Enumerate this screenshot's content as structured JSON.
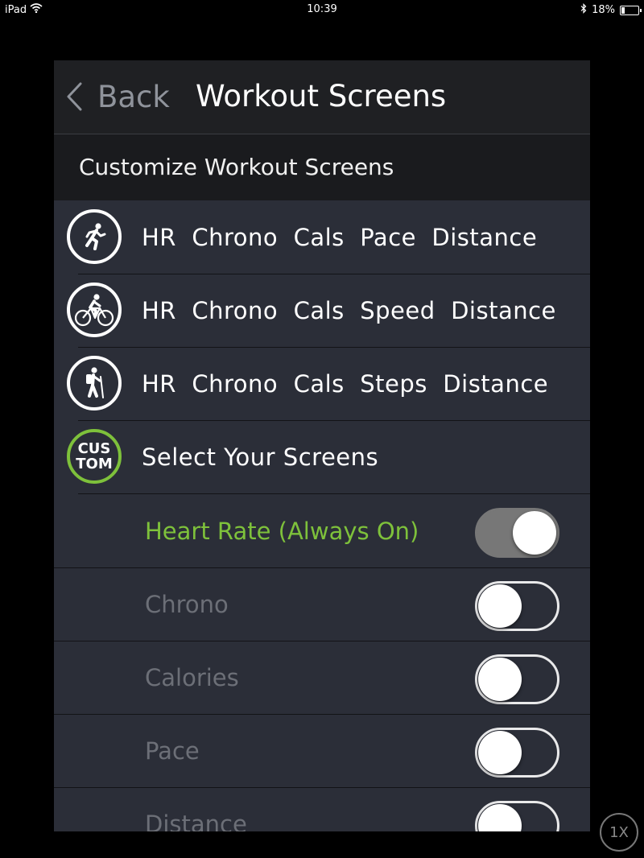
{
  "status_bar": {
    "device": "iPad",
    "time": "10:39",
    "battery_percent": "18%",
    "battery_level": 0.18,
    "icons": [
      "wifi-icon",
      "bluetooth-icon",
      "battery-icon"
    ]
  },
  "nav": {
    "back_label": "Back",
    "title": "Workout Screens"
  },
  "section_header": "Customize Workout Screens",
  "presets": [
    {
      "icon": "running-icon",
      "label": "HR  Chrono  Cals  Pace  Distance"
    },
    {
      "icon": "cycling-icon",
      "label": "HR  Chrono  Cals  Speed  Distance"
    },
    {
      "icon": "hiking-icon",
      "label": "HR  Chrono  Cals  Steps  Distance"
    }
  ],
  "custom": {
    "icon_text_line1": "CUS",
    "icon_text_line2": "TOM",
    "label": "Select Your Screens"
  },
  "toggles": [
    {
      "label": "Heart Rate (Always On)",
      "on": true
    },
    {
      "label": "Chrono",
      "on": false
    },
    {
      "label": "Calories",
      "on": false
    },
    {
      "label": "Pace",
      "on": false
    },
    {
      "label": "Distance",
      "on": false
    }
  ],
  "zoom_button": "1X",
  "colors": {
    "accent_green": "#7ec13b",
    "list_background": "#2b2e38",
    "nav_background": "#1f2023",
    "disabled_text": "#6c6f77"
  }
}
